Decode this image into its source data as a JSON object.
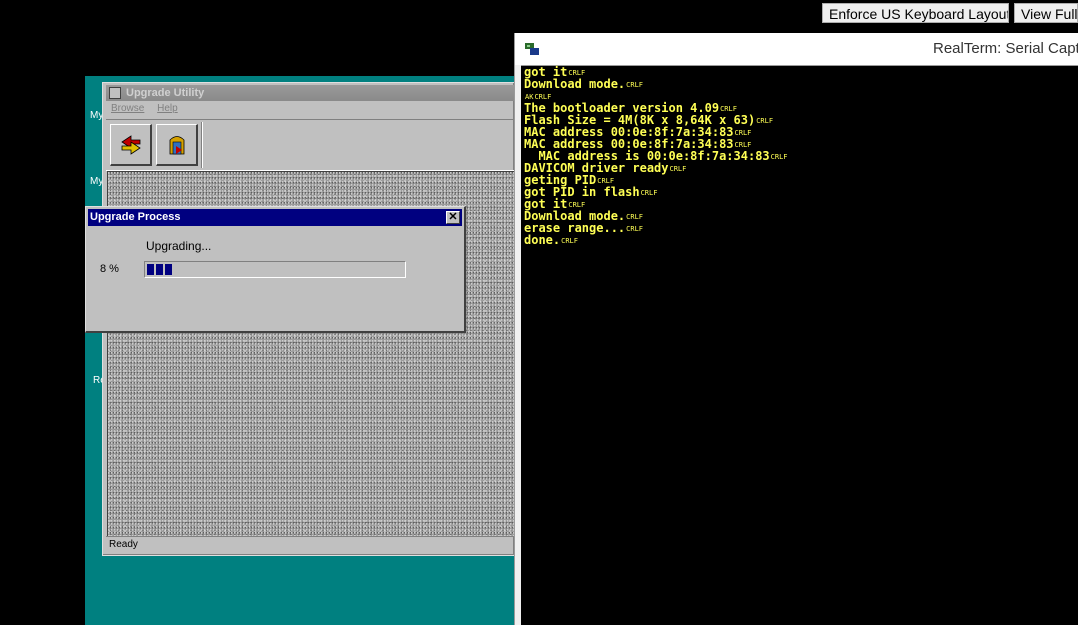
{
  "topbar": {
    "enforce_keyboard_label": "Enforce US Keyboard Layout",
    "view_fullscreen_label": "View Fulls"
  },
  "desktop": {
    "labels": [
      "My",
      "My",
      "Re"
    ]
  },
  "upgrade_utility": {
    "title": "Upgrade Utility",
    "menu": [
      "Browse",
      "Help"
    ],
    "status": "Ready"
  },
  "upgrade_process": {
    "title": "Upgrade Process",
    "close_glyph": "✕",
    "status_text": "Upgrading...",
    "percent_text": "8 %",
    "progress_fraction": 0.08
  },
  "realterm": {
    "title": "RealTerm: Serial Captu",
    "crlf_marker": "CRLF",
    "lines": [
      {
        "text": "got it",
        "crlf": true
      },
      {
        "text": "Download mode.",
        "crlf": true
      },
      {
        "text": "",
        "crlf": true,
        "prefix": "AK"
      },
      {
        "text": "The bootloader version 4.09",
        "crlf": true
      },
      {
        "text": "Flash Size = 4M(8K x 8,64K x 63)",
        "crlf": true
      },
      {
        "text": "MAC address 00:0e:8f:7a:34:83",
        "crlf": true
      },
      {
        "text": "MAC address 00:0e:8f:7a:34:83",
        "crlf": true
      },
      {
        "text": "  MAC address is 00:0e:8f:7a:34:83",
        "crlf": true
      },
      {
        "text": "DAVICOM driver ready",
        "crlf": true
      },
      {
        "text": "geting PID",
        "crlf": true
      },
      {
        "text": "got PID in flash",
        "crlf": true
      },
      {
        "text": "got it",
        "crlf": true
      },
      {
        "text": "Download mode.",
        "crlf": true
      },
      {
        "text": "erase range...",
        "crlf": true
      },
      {
        "text": "done.",
        "crlf": true
      }
    ]
  },
  "colors": {
    "desktop_teal": "#008080",
    "dialog_title_blue": "#000080",
    "terminal_text": "#ffff55"
  },
  "icons": {
    "upgrade_utility": "app-icon",
    "toolbar_1": "recycle-arrows-icon",
    "toolbar_2": "door-exit-icon",
    "realterm": "serial-port-icon"
  }
}
